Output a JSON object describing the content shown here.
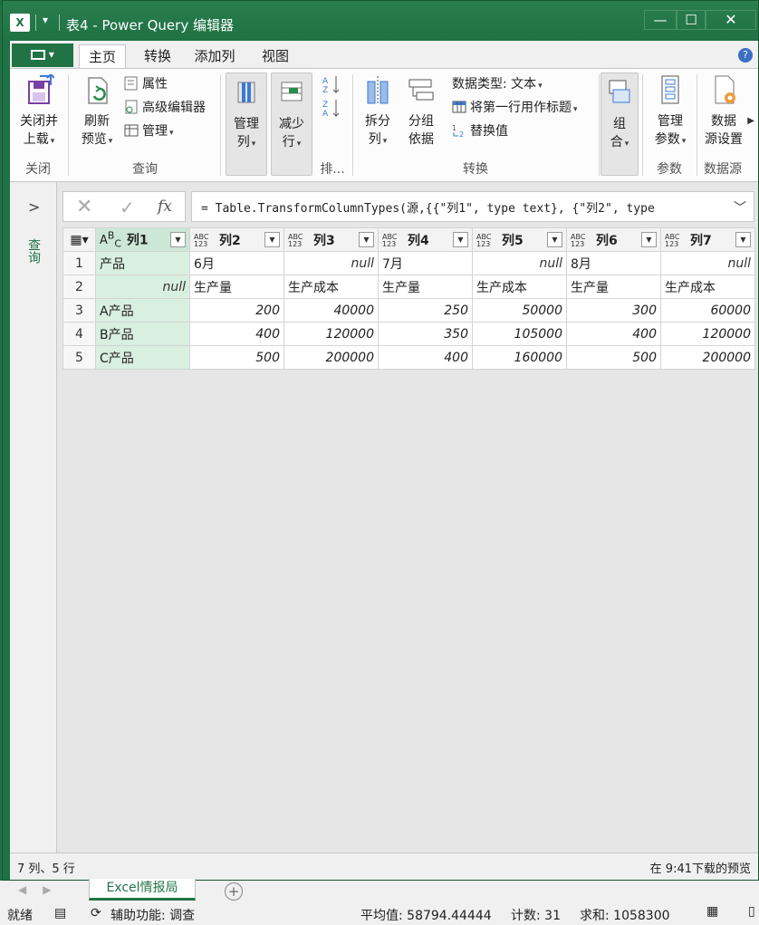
{
  "window": {
    "app_icon": "X",
    "title": "表4 - Power Query 编辑器",
    "minimize": "—",
    "maximize": "☐",
    "close": "✕"
  },
  "tabs": [
    {
      "label": "主页"
    },
    {
      "label": "转换"
    },
    {
      "label": "添加列"
    },
    {
      "label": "视图"
    }
  ],
  "help_icon": "?",
  "ribbon": {
    "close": {
      "btn_line1": "关闭并",
      "btn_line2": "上载",
      "group": "关闭"
    },
    "query": {
      "refresh_line1": "刷新",
      "refresh_line2": "预览",
      "properties": "属性",
      "advanced_editor": "高级编辑器",
      "manage": "管理",
      "group": "查询"
    },
    "manage_cols": {
      "line1": "管理",
      "line2": "列"
    },
    "reduce_rows": {
      "line1": "减少",
      "line2": "行"
    },
    "sort": {
      "group": "排..."
    },
    "transform": {
      "split_line1": "拆分",
      "split_line2": "列",
      "group_line1": "分组",
      "group_line2": "依据",
      "data_type": "数据类型: 文本",
      "first_row_header": "将第一行用作标题",
      "replace_values": "替换值",
      "group": "转换"
    },
    "combine": {
      "line1": "组",
      "line2": "合"
    },
    "params": {
      "line1": "管理",
      "line2": "参数",
      "group": "参数"
    },
    "datasource": {
      "line1": "数据",
      "line2": "源设置",
      "group": "数据源"
    }
  },
  "nav": {
    "label": "查询",
    "expand": ">"
  },
  "formula": {
    "text": "= Table.TransformColumnTypes(源,{{\"列1\", type text}, {\"列2\", type"
  },
  "grid": {
    "columns": [
      {
        "type": "ABC",
        "name": "列1"
      },
      {
        "type": "ABC123",
        "name": "列2"
      },
      {
        "type": "ABC123",
        "name": "列3"
      },
      {
        "type": "ABC123",
        "name": "列4"
      },
      {
        "type": "ABC123",
        "name": "列5"
      },
      {
        "type": "ABC123",
        "name": "列6"
      },
      {
        "type": "ABC123",
        "name": "列7"
      }
    ],
    "rows": [
      {
        "n": "1",
        "cells": [
          "产品",
          "6月",
          "null",
          "7月",
          "null",
          "8月",
          "null"
        ]
      },
      {
        "n": "2",
        "cells": [
          "null",
          "生产量",
          "生产成本",
          "生产量",
          "生产成本",
          "生产量",
          "生产成本"
        ]
      },
      {
        "n": "3",
        "cells": [
          "A产品",
          "200",
          "40000",
          "250",
          "50000",
          "300",
          "60000"
        ]
      },
      {
        "n": "4",
        "cells": [
          "B产品",
          "400",
          "120000",
          "350",
          "105000",
          "400",
          "120000"
        ]
      },
      {
        "n": "5",
        "cells": [
          "C产品",
          "500",
          "200000",
          "400",
          "160000",
          "500",
          "200000"
        ]
      }
    ]
  },
  "status": {
    "left": "7 列、5 行",
    "right": "在 9:41下载的预览"
  },
  "sheet": {
    "tab": "Excel情报局",
    "add": "+"
  },
  "statusbar": {
    "ready": "就绪",
    "accessibility": "辅助功能: 调查",
    "average": "平均值: 58794.44444",
    "count": "计数: 31",
    "sum": "求和: 1058300"
  },
  "colors": {
    "accent": "#217346",
    "selected_col": "#d9efe0"
  }
}
